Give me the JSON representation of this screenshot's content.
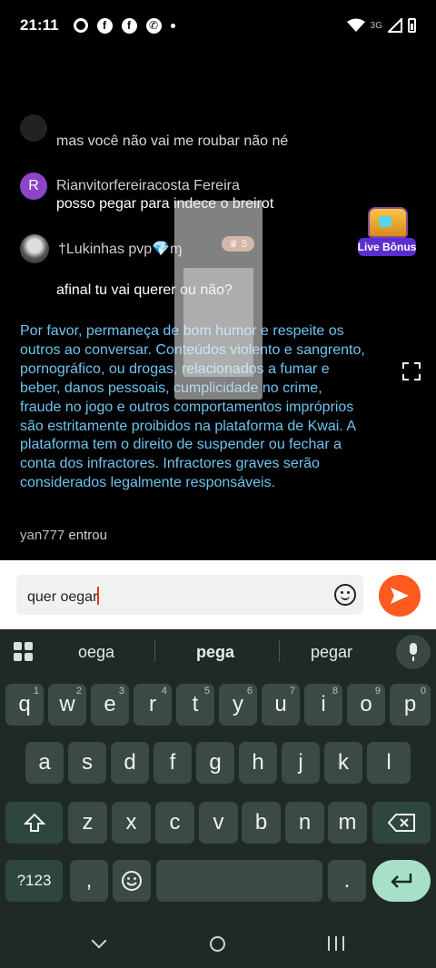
{
  "status_bar": {
    "time": "21:11",
    "network": "3G",
    "icons": [
      "radio-icon",
      "facebook-icon",
      "facebook-icon",
      "whatsapp-icon",
      "dot-icon",
      "wifi-icon",
      "signal-icon",
      "battery-icon"
    ]
  },
  "chat": {
    "messages": [
      {
        "user": "",
        "text": "mas você não vai me roubar não né"
      },
      {
        "avatar_letter": "R",
        "user": "Rianvitorfereiracosta Fereira",
        "text": "posso pegar para indece o breirot"
      },
      {
        "user": "†Lukinhas pvp",
        "gem": "💎",
        "suffix": "ɱ",
        "level": "5",
        "text": "afinal tu vai querer ou não?"
      }
    ],
    "notice": "Por favor, permaneça de bom humor e respeite os outros ao conversar. Conteúdos violento e sangrento, pornográfico, ou drogas, relacionados a fumar e beber, danos pessoais, cumplicidade no crime, fraude no jogo e outros comportamentos impróprios são estritamente proibidos na plataforma de Kwai. A plataforma tem o direito de suspender ou fechar a conta dos infractores. Infractores graves serão considerados legalmente responsáveis.",
    "join": {
      "user": "yan777",
      "action": "entrou"
    }
  },
  "live_bonus": {
    "label": "Live Bônus"
  },
  "input": {
    "value": "quer oegar"
  },
  "keyboard": {
    "suggestions": [
      "oega",
      "pega",
      "pegar"
    ],
    "row1": [
      {
        "k": "q",
        "h": "1"
      },
      {
        "k": "w",
        "h": "2"
      },
      {
        "k": "e",
        "h": "3"
      },
      {
        "k": "r",
        "h": "4"
      },
      {
        "k": "t",
        "h": "5"
      },
      {
        "k": "y",
        "h": "6"
      },
      {
        "k": "u",
        "h": "7"
      },
      {
        "k": "i",
        "h": "8"
      },
      {
        "k": "o",
        "h": "9"
      },
      {
        "k": "p",
        "h": "0"
      }
    ],
    "row2": [
      "a",
      "s",
      "d",
      "f",
      "g",
      "h",
      "j",
      "k",
      "l"
    ],
    "row3": [
      "z",
      "x",
      "c",
      "v",
      "b",
      "n",
      "m"
    ],
    "symbols_label": "?123",
    "comma": ",",
    "period": "."
  },
  "colors": {
    "notice": "#6ec3ef",
    "send": "#ff5a1f",
    "caret": "#e0391b",
    "live_bonus": "#5a2fd0",
    "keyboard_bg": "#1f2a26"
  }
}
